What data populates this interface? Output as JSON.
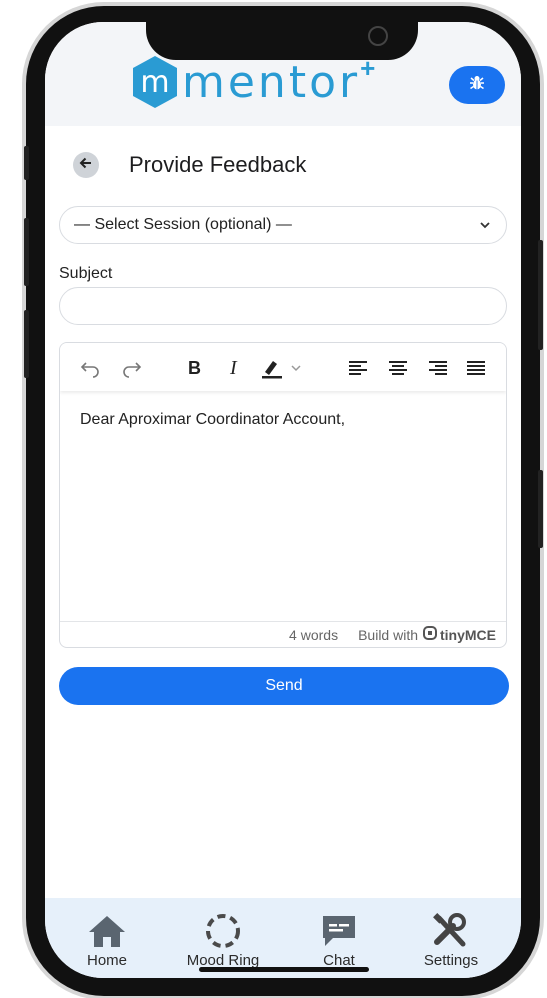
{
  "header": {
    "logo_text": "mentor",
    "logo_plus": "+",
    "bug_icon": "bug-icon",
    "brand_color": "#2a9bd3",
    "accent_color": "#1a73f0"
  },
  "page": {
    "title": "Provide Feedback",
    "back_icon": "arrow-left-icon"
  },
  "form": {
    "session_select": "— Select Session (optional) —",
    "subject_label": "Subject",
    "subject_value": "",
    "send_label": "Send"
  },
  "editor": {
    "toolbar": [
      "undo-icon",
      "redo-icon",
      "bold-icon",
      "italic-icon",
      "highlight-icon",
      "chevron-down-icon",
      "align-left-icon",
      "align-center-icon",
      "align-right-icon",
      "align-justify-icon"
    ],
    "bold_label": "B",
    "italic_label": "I",
    "content": "Dear Aproximar Coordinator Account,",
    "word_count": "4 words",
    "build_with": "Build with",
    "brand": "tinyMCE"
  },
  "nav": {
    "items": [
      {
        "label": "Home",
        "icon": "home-icon"
      },
      {
        "label": "Mood Ring",
        "icon": "mood-ring-icon"
      },
      {
        "label": "Chat",
        "icon": "chat-icon"
      },
      {
        "label": "Settings",
        "icon": "settings-icon"
      }
    ]
  }
}
